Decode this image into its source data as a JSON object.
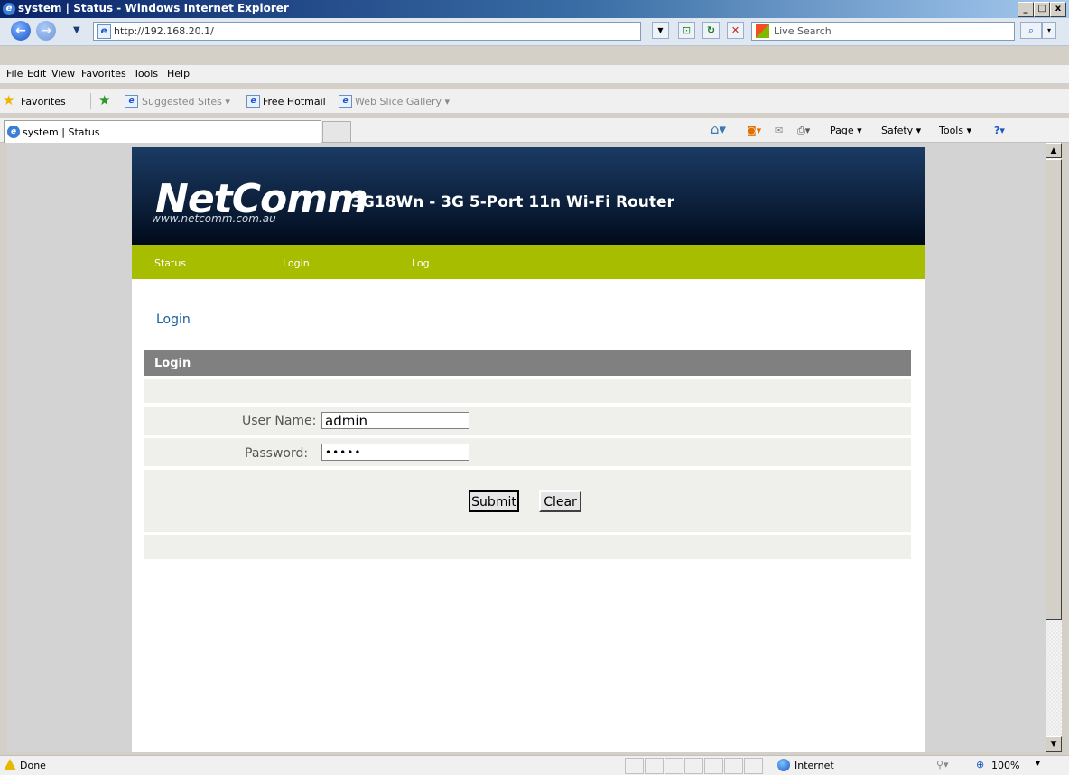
{
  "window": {
    "title": "system | Status - Windows Internet Explorer",
    "controls": [
      "_",
      "□",
      "x"
    ]
  },
  "address_bar": {
    "url": "http://192.168.20.1/",
    "search_placeholder": "Live Search"
  },
  "menu": [
    "File",
    "Edit",
    "View",
    "Favorites",
    "Tools",
    "Help"
  ],
  "favorites_bar": {
    "favorites_label": "Favorites",
    "links": [
      "Suggested Sites ▾",
      "Free Hotmail",
      "Web Slice Gallery ▾"
    ]
  },
  "tab": {
    "label": "system | Status"
  },
  "command_bar": [
    "Page ▾",
    "Safety ▾",
    "Tools ▾"
  ],
  "router_page": {
    "logo": "NetComm",
    "logo_url": "www.netcomm.com.au",
    "product": "3G18Wn - 3G 5-Port 11n Wi-Fi Router",
    "nav": [
      "Status",
      "Login",
      "Log"
    ],
    "breadcrumb": "Login",
    "form": {
      "header": "Login",
      "username_label": "User Name:",
      "username_value": "admin",
      "password_label": "Password:",
      "password_value": "•••••",
      "submit_label": "Submit",
      "clear_label": "Clear"
    }
  },
  "status_bar": {
    "text": "Done",
    "zone": "Internet",
    "zoom": "100%"
  }
}
